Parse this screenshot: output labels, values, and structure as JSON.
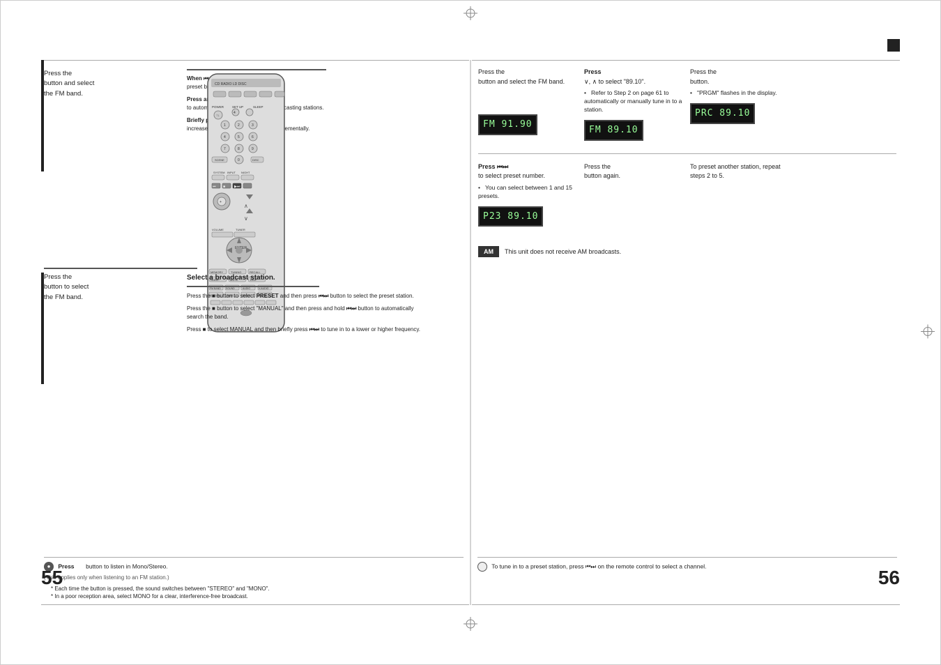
{
  "pages": {
    "left_page_num": "55",
    "right_page_num": "56"
  },
  "left_page": {
    "section1": {
      "press_text": "Press the",
      "button_action": "button and select",
      "band_text": "the FM band.",
      "note1_title": "When ⏮⏭ is pressed, a",
      "note1_body": "preset broadcast station is selected.",
      "note2_title": "Press and hold",
      "note2_body": "∨, ∧ to automatically search for active broadcasting stations.",
      "note3_title": "Briefly press",
      "note3_body": "∨, ∧ to increase or decrease the frequency incrementally."
    },
    "section2": {
      "press_text": "Press the",
      "button_action": "button to select",
      "band_text": "the FM band.",
      "select_text": "Select a broadcast station.",
      "instructions": [
        "Press the ■ button to select PRESET and then press ⏮⏭ button to select the preset station.",
        "Press the ■ button to select \"MANUAL\" and then press and hold ⏮⏭ button to automatically search the band.",
        "Press ■ to select MANUAL and then briefly press ⏮⏭ to tune in to a lower or higher frequency."
      ]
    }
  },
  "right_page": {
    "step1": {
      "title": "Press the",
      "subtitle": "button and select the FM band.",
      "display": "FM  91.90"
    },
    "step2": {
      "title": "Press",
      "subtitle": "∨, ∧  to select \"89.10\".",
      "note1": "Refer to Step 2 on page 61 to automatically or manually tune in to a station.",
      "display": "FM  89.10"
    },
    "step3": {
      "title": "Press the",
      "subtitle": "button.",
      "note1": "\"PRGM\" flashes in the display.",
      "display": "PRC  89.10"
    },
    "section_lower": {
      "step_a_title": "Press ⏮⏭",
      "step_a_sub": "to select preset number.",
      "step_a_note": "You can select between 1 and 15 presets.",
      "step_a_display": "P23  89.10",
      "step_b_title": "Press the",
      "step_b_sub": "button again.",
      "step_c_title": "To preset another station, repeat steps 2 to 5."
    },
    "am_note": {
      "label": "AM",
      "text": "This unit does not receive AM broadcasts."
    }
  },
  "bottom_notes": {
    "left": {
      "icon": "●",
      "title": "Press",
      "button_label": "button to listen in Mono/Stereo.",
      "sub": "(This applies only when listening to an FM station.)",
      "bullets": [
        "Each time the button is pressed, the sound switches between \"STEREO\" and \"MONO\".",
        "In a poor reception area, select MONO for a clear, interference-free broadcast."
      ]
    },
    "right": {
      "icon": "○",
      "title": "To tune in to a preset station, press ⏮⏭ on the remote control to select a channel."
    }
  }
}
